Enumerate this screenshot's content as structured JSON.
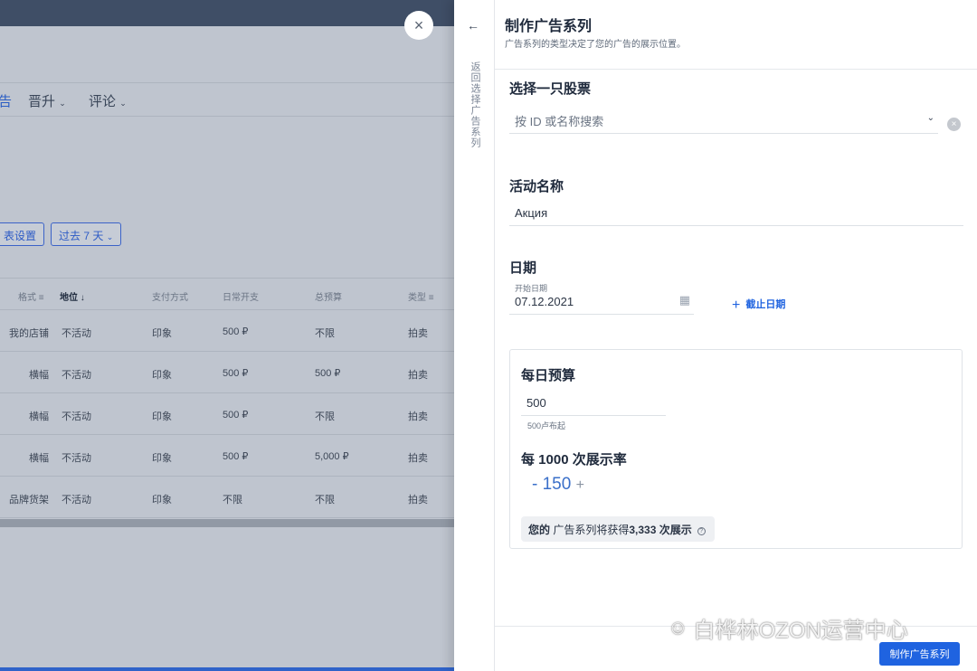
{
  "background": {
    "nav": [
      "告",
      "晋升",
      "评论"
    ],
    "buttons": [
      "表设置",
      "过去 7 天"
    ],
    "columns": [
      "格式",
      "地位",
      "支付方式",
      "日常开支",
      "总预算",
      "类型"
    ],
    "rows": [
      [
        "我的店铺",
        "不活动",
        "印象",
        "500 ₽",
        "不限",
        "拍卖"
      ],
      [
        "横幅",
        "不活动",
        "印象",
        "500 ₽",
        "500 ₽",
        "拍卖"
      ],
      [
        "横幅",
        "不活动",
        "印象",
        "500 ₽",
        "不限",
        "拍卖"
      ],
      [
        "横幅",
        "不活动",
        "印象",
        "500 ₽",
        "5,000 ₽",
        "拍卖"
      ],
      [
        "品牌货架",
        "不活动",
        "印象",
        "不限",
        "不限",
        "拍卖"
      ]
    ],
    "close_glyph": "×"
  },
  "strip": {
    "back_glyph": "←",
    "label": "返回选择广告系列"
  },
  "panel": {
    "title": "制作广告系列",
    "subtitle": "广告系列的类型决定了您的广告的展示位置。",
    "stock": {
      "heading": "选择一只股票",
      "placeholder": "按 ID 或名称搜索"
    },
    "activity": {
      "heading": "活动名称",
      "value": "Акция"
    },
    "date": {
      "heading": "日期",
      "start_label": "开始日期",
      "start_value": "07.12.2021",
      "end_link": "截止日期"
    },
    "budget": {
      "heading": "每日预算",
      "value": "500",
      "hint": "500卢布起",
      "rate_heading": "每 1000 次展示率",
      "minus": "-",
      "rate_value": "150",
      "plus": "+",
      "notice_prefix": "您的",
      "notice_mid": "广告系列将获得",
      "notice_strong": "3,333 次展示"
    },
    "submit": "制作广告系列"
  },
  "watermark": "白桦林OZON运营中心"
}
